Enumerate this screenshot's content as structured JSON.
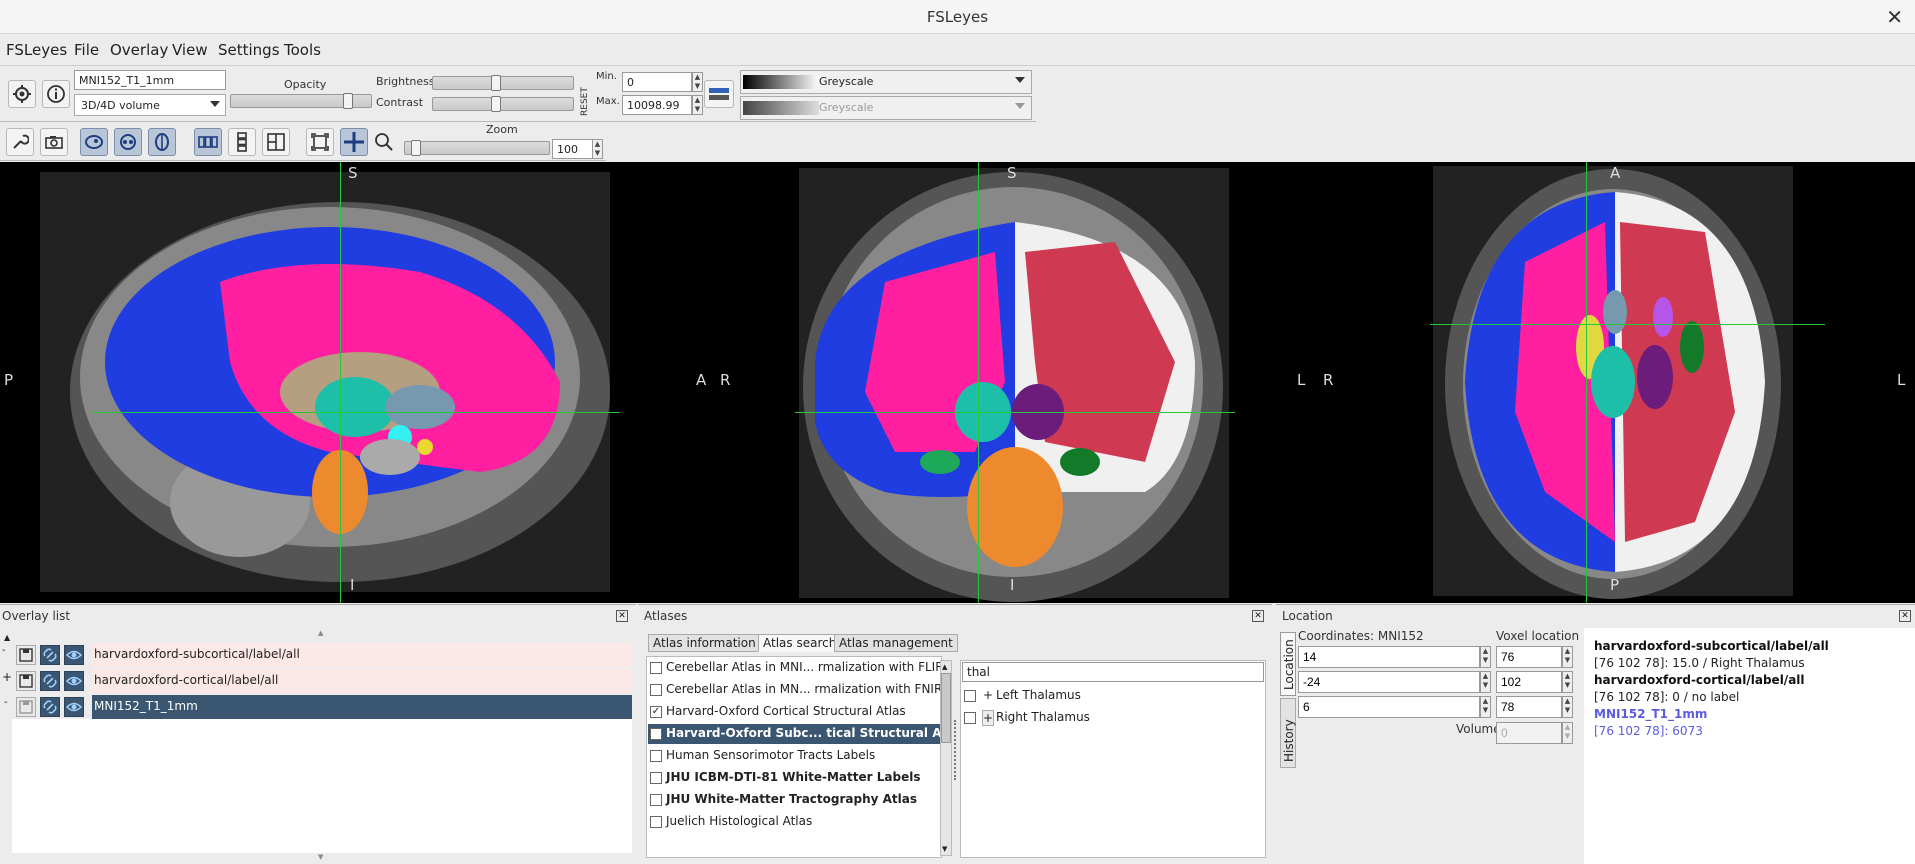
{
  "window": {
    "title": "FSLeyes"
  },
  "menu": [
    "FSLeyes",
    "File",
    "Overlay",
    "View",
    "Settings",
    "Tools"
  ],
  "toolbar": {
    "overlay_name": "MNI152_T1_1mm",
    "overlay_type": "3D/4D volume",
    "opacity_label": "Opacity",
    "brightness_label": "Brightness",
    "contrast_label": "Contrast",
    "reset_label": "RESET",
    "min_label": "Min.",
    "max_label": "Max.",
    "min_value": "0",
    "max_value": "10098.99",
    "colormap": "Greyscale",
    "neg_colormap": "Greyscale",
    "zoom_label": "Zoom",
    "zoom_value": "100"
  },
  "views": {
    "sagittal": {
      "top": "S",
      "bottom": "I",
      "left": "P",
      "right": "A"
    },
    "coronal": {
      "top": "S",
      "bottom": "I",
      "left": "R",
      "right": "L"
    },
    "axial": {
      "top": "A",
      "bottom": "P",
      "left": "R",
      "right": "L"
    }
  },
  "overlay_list": {
    "title": "Overlay list",
    "items": [
      {
        "name": "harvardoxford-subcortical/label/all",
        "selected": false
      },
      {
        "name": "harvardoxford-cortical/label/all",
        "selected": false
      },
      {
        "name": "MNI152_T1_1mm",
        "selected": true
      }
    ]
  },
  "atlases": {
    "title": "Atlases",
    "tabs": [
      "Atlas information",
      "Atlas search",
      "Atlas management"
    ],
    "active_tab": "Atlas search",
    "list": [
      {
        "name": "Cerebellar Atlas in MNI... rmalization with FLIRT",
        "checked": false,
        "bold": false
      },
      {
        "name": "Cerebellar Atlas in MN... rmalization with FNIRT",
        "checked": false,
        "bold": false
      },
      {
        "name": "Harvard-Oxford Cortical Structural Atlas",
        "checked": true,
        "bold": false
      },
      {
        "name": "Harvard-Oxford Subc... tical Structural Atlas",
        "checked": true,
        "bold": true,
        "selected": true
      },
      {
        "name": "Human Sensorimotor Tracts Labels",
        "checked": false,
        "bold": false
      },
      {
        "name": "JHU ICBM-DTI-81 White-Matter Labels",
        "checked": false,
        "bold": true
      },
      {
        "name": "JHU White-Matter Tractography Atlas",
        "checked": false,
        "bold": true
      },
      {
        "name": "Juelich Histological Atlas",
        "checked": false,
        "bold": false
      }
    ],
    "search_value": "thal",
    "results": [
      {
        "name": "Left Thalamus"
      },
      {
        "name": "Right Thalamus"
      }
    ]
  },
  "location": {
    "title": "Location",
    "side_tabs": [
      "Location",
      "History"
    ],
    "coord_label": "Coordinates: MNI152",
    "voxel_label": "Voxel location",
    "coords": [
      "14",
      "-24",
      "6"
    ],
    "voxels": [
      "76",
      "102",
      "78"
    ],
    "volume_label": "Volume",
    "volume_value": "0",
    "info": [
      {
        "text": "harvardoxford-subcortical/label/all",
        "bold": true,
        "color": "#111111"
      },
      {
        "text": "[76 102 78]: 15.0 / Right Thalamus",
        "bold": false,
        "color": "#222222"
      },
      {
        "text": "harvardoxford-cortical/label/all",
        "bold": true,
        "color": "#111111"
      },
      {
        "text": "[76 102 78]: 0 / no label",
        "bold": false,
        "color": "#222222"
      },
      {
        "text": "MNI152_T1_1mm",
        "bold": true,
        "color": "#5b5be0"
      },
      {
        "text": "[76 102 78]: 6073",
        "bold": false,
        "color": "#5b5be0"
      }
    ]
  },
  "colors": {
    "crosshair": "#22c93a",
    "selected_row": "#3b5670",
    "overlay_row": "#fde8e8",
    "accent": "#2f62b6"
  }
}
